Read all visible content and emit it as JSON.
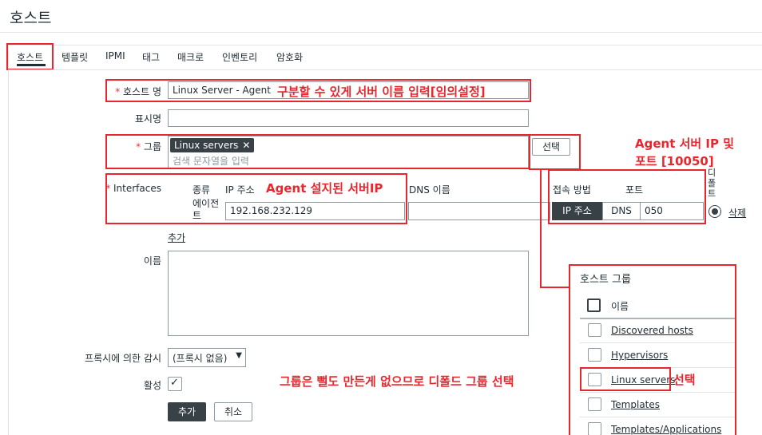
{
  "page": {
    "title": "호스트"
  },
  "tabs": [
    {
      "label": "호스트"
    },
    {
      "label": "템플릿"
    },
    {
      "label": "IPMI"
    },
    {
      "label": "태그"
    },
    {
      "label": "매크로"
    },
    {
      "label": "인벤토리"
    },
    {
      "label": "암호화"
    }
  ],
  "form": {
    "host_name_label": "호스트 명",
    "host_name_value": "Linux Server - Agent",
    "display_name_label": "표시명",
    "group_label": "그룹",
    "group_chip": "Linux servers",
    "group_search_placeholder": "검색 문자열을 입력",
    "select_button": "선택",
    "interfaces_label": "Interfaces",
    "col_type": "종류",
    "col_ip": "IP 주소",
    "col_dns": "DNS 이름",
    "col_connect": "접속 방법",
    "col_port": "포트",
    "col_default": "디폴트",
    "iface_type": "에이전트",
    "iface_ip": "192.168.232.129",
    "seg_ip": "IP 주소",
    "seg_dns": "DNS",
    "port_value": "050",
    "remove": "삭제",
    "add_iface": "추가",
    "description_label": "이름",
    "proxy_label": "프록시에 의한 감시",
    "proxy_value": "(프록시 없음)",
    "enabled_label": "활성",
    "add_button": "추가",
    "cancel_button": "취소"
  },
  "popup": {
    "title": "호스트 그룹",
    "header": "이름",
    "items": [
      "Discovered hosts",
      "Hypervisors",
      "Linux servers",
      "Templates",
      "Templates/Applications"
    ]
  },
  "annotations": {
    "host_name": "구분할 수 있게 서버 이름 입력[임의설정]",
    "agent_ip": "Agent 설지된 서버IP",
    "agent_port_1": "Agent 서버 IP 및",
    "agent_port_2": "포트 [10050]",
    "group_note": "그룹은 뻘도 만든게 없으므로 디폴드 그룹 선택",
    "select_note": "선택"
  },
  "colors": {
    "accent_red": "#e8262d",
    "dark": "#384146"
  }
}
